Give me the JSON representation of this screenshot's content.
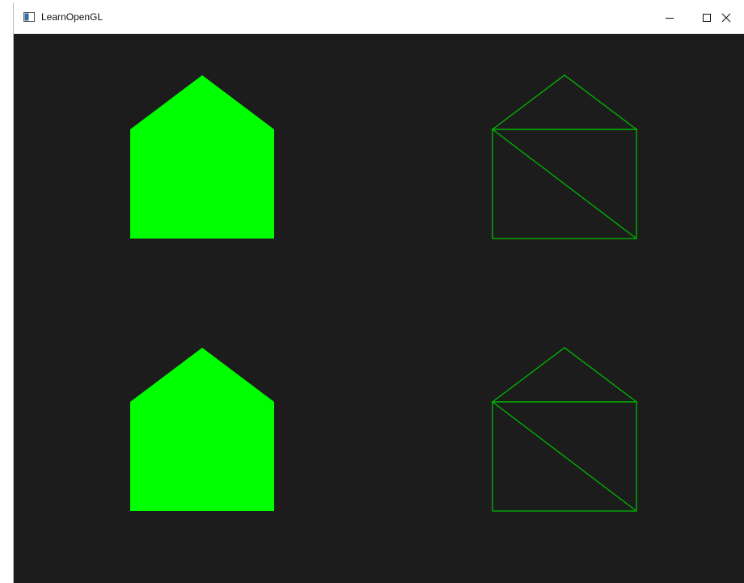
{
  "window": {
    "title": "LearnOpenGL",
    "app_icon": "window-app-icon",
    "controls": {
      "minimize_icon": "minimize-icon",
      "maximize_icon": "maximize-icon",
      "close_icon": "close-icon"
    }
  },
  "scene": {
    "background_color": "#1c1c1c",
    "fill_color": "#00ff00",
    "wire_color": "#00b800",
    "shapes": [
      {
        "name": "filled-house-top-left",
        "render_mode": "filled"
      },
      {
        "name": "wireframe-house-top-right",
        "render_mode": "wireframe"
      },
      {
        "name": "filled-house-bottom-left",
        "render_mode": "filled"
      },
      {
        "name": "wireframe-house-bottom-right",
        "render_mode": "wireframe"
      }
    ]
  }
}
